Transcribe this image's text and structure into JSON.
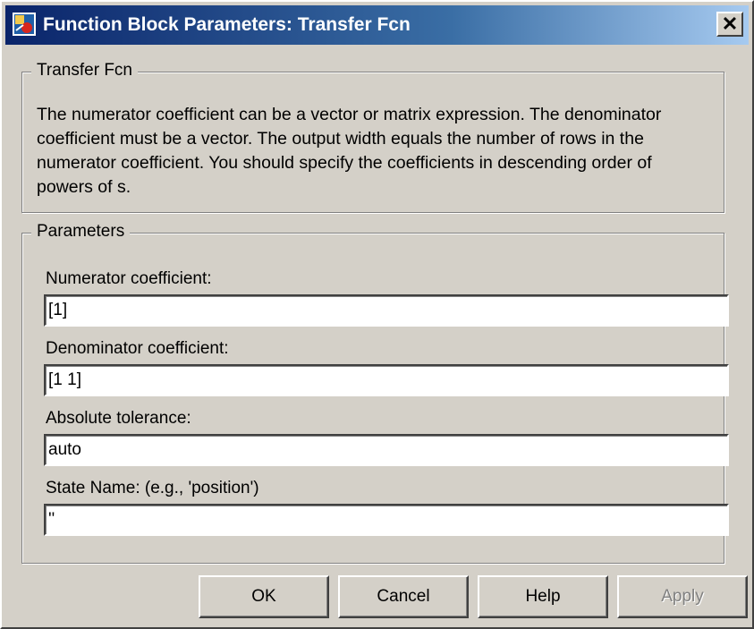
{
  "window": {
    "title": "Function Block Parameters: Transfer Fcn",
    "close_label": "✕"
  },
  "description_group": {
    "legend": "Transfer Fcn",
    "text": "The numerator coefficient can be a vector or matrix expression. The denominator coefficient must be a vector. The output width equals the number of rows in the numerator coefficient. You should specify the coefficients in descending order of powers of s."
  },
  "parameters": {
    "legend": "Parameters",
    "fields": [
      {
        "label": "Numerator coefficient:",
        "value": "[1]"
      },
      {
        "label": "Denominator coefficient:",
        "value": "[1 1]"
      },
      {
        "label": "Absolute tolerance:",
        "value": "auto"
      },
      {
        "label": "State Name: (e.g., 'position')",
        "value": "''"
      }
    ]
  },
  "buttons": {
    "ok": "OK",
    "cancel": "Cancel",
    "help": "Help",
    "apply": "Apply"
  },
  "colors": {
    "dialog_bg": "#d4d0c8",
    "titlebar_start": "#0a246a",
    "titlebar_end": "#a6caf0"
  }
}
